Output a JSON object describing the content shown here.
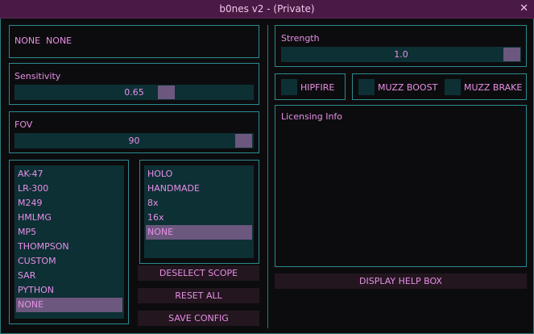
{
  "window": {
    "title": "b0nes v2 - (Private)",
    "close_glyph": "✕"
  },
  "status": {
    "text": "NONE  NONE"
  },
  "sensitivity": {
    "label": "Sensitivity",
    "value": "0.65",
    "level": 0.65
  },
  "fov": {
    "label": "FOV",
    "value": "90"
  },
  "strength": {
    "label": "Strength",
    "value": "1.0"
  },
  "toggles": {
    "hipfire": "HIPFIRE",
    "muzz_boost": "MUZZ BOOST",
    "muzz_brake": "MUZZ BRAKE"
  },
  "licensing": {
    "label": "Licensing Info"
  },
  "weapons": {
    "items": [
      "AK-47",
      "LR-300",
      "M249",
      "HMLMG",
      "MP5",
      "THOMPSON",
      "CUSTOM",
      "SAR",
      "PYTHON",
      "NONE"
    ],
    "selected": "NONE"
  },
  "scopes": {
    "items": [
      "HOLO",
      "HANDMADE",
      "8x",
      "16x",
      "NONE"
    ],
    "selected": "NONE"
  },
  "buttons": {
    "deselect_scope": "DESELECT SCOPE",
    "reset_all": "RESET ALL",
    "save_config": "SAVE CONFIG",
    "display_help": "DISPLAY HELP BOX"
  },
  "colors": {
    "accent": "#e88fe6",
    "border": "#2a8b8e",
    "fill": "#0d3035",
    "thumb": "#6c577e",
    "titlebar": "#4a1a45"
  }
}
